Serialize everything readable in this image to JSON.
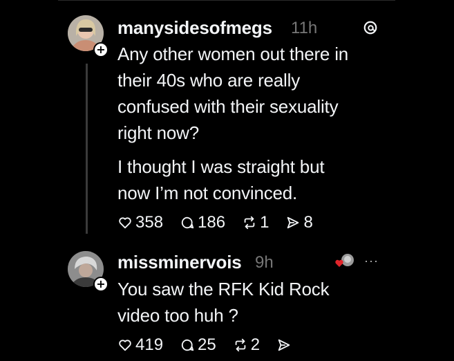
{
  "post": {
    "username": "manysidesofmegs",
    "time": "11h",
    "paragraph1_lines": [
      "Any other women out there in",
      "their 40s who are really",
      "confused with their sexuality",
      "right now?"
    ],
    "paragraph2_lines": [
      "I thought I was straight but",
      "now I’m not convinced."
    ],
    "likes": "358",
    "comments": "186",
    "reposts": "1",
    "shares": "8"
  },
  "reply": {
    "username": "missminervois",
    "time": "9h",
    "lines": [
      "You saw the RFK Kid Rock",
      "video too huh ?"
    ],
    "likes": "419",
    "comments": "25",
    "reposts": "2",
    "more": "···"
  },
  "icons": {
    "like": "heart-icon",
    "comment": "comment-bubble-icon",
    "repost": "repost-icon",
    "share": "send-icon",
    "threads": "threads-logo-icon",
    "follow": "plus-icon"
  },
  "colors": {
    "background": "#000000",
    "text": "#f3f5f7",
    "muted": "#777777",
    "heart_badge": "#e0252a"
  }
}
